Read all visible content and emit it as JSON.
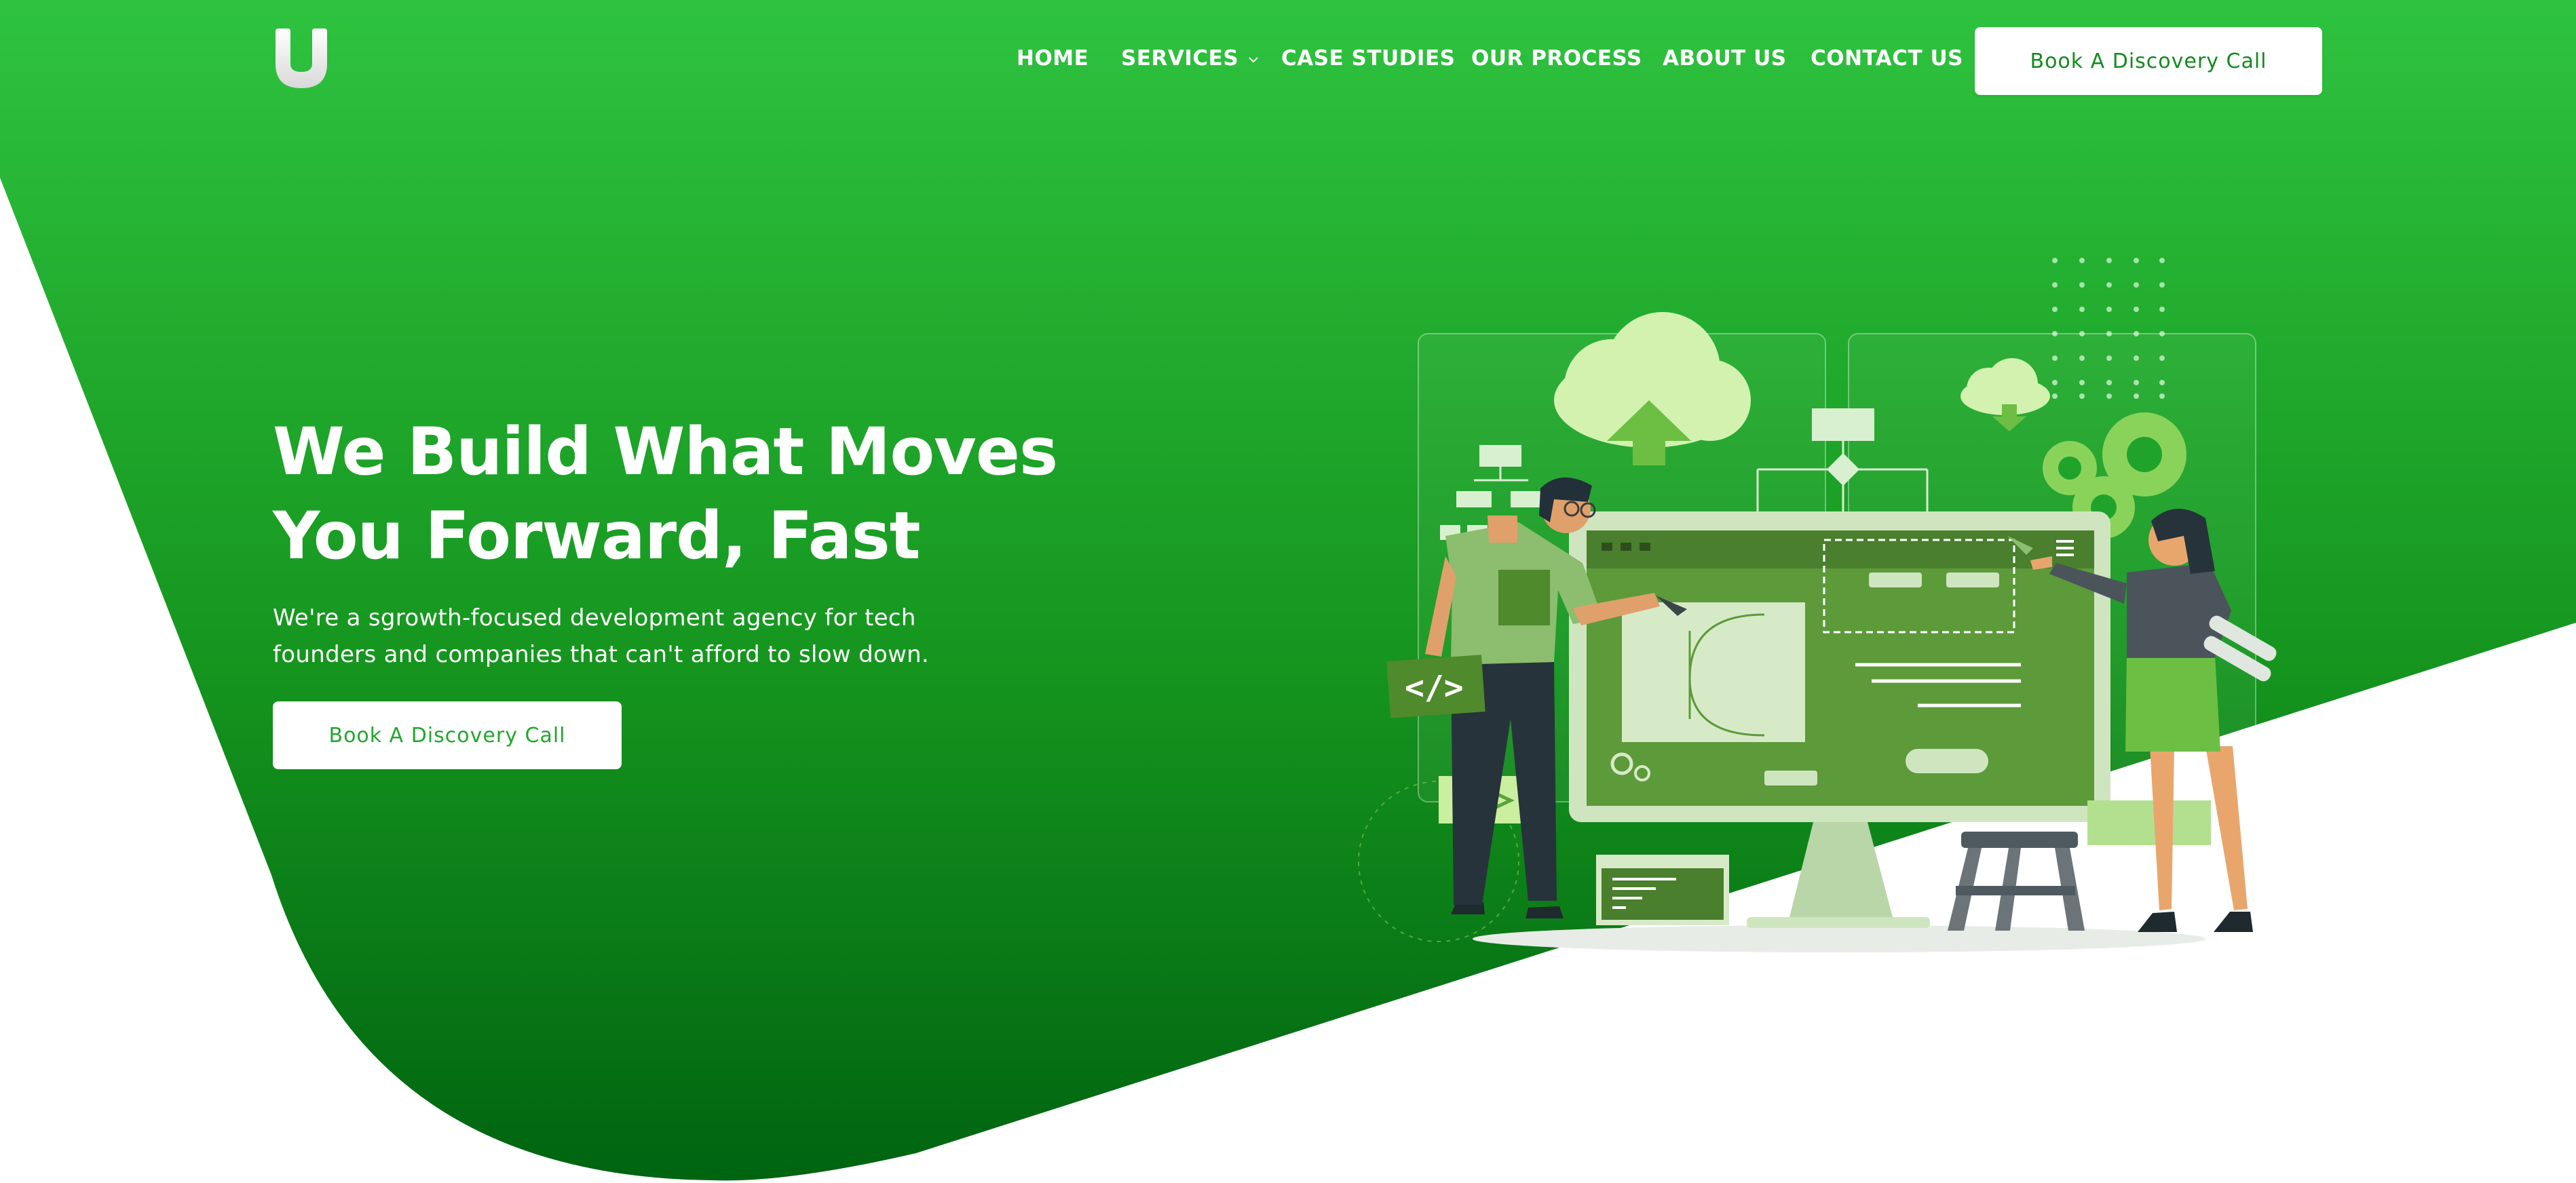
{
  "nav": {
    "items": [
      "HOME",
      "SERVICES",
      "CASE STUDIES",
      "OUR PROCESS",
      "ABOUT US",
      "CONTACT US"
    ],
    "cta_label": "Book A Discovery Call"
  },
  "hero": {
    "title_line1": "We Build What Moves",
    "title_line2": "You Forward, Fast",
    "subtitle_line1": "We're a sgrowth-focused development agency for tech",
    "subtitle_line2": "founders and companies that can't afford to slow down.",
    "cta_label": "Book A Discovery Call"
  },
  "icons": {
    "logo": "u-logo-icon",
    "services_dropdown": "chevron-down-icon",
    "code_tag": "code-tag-icon",
    "upload_cloud": "cloud-upload-icon",
    "download_cloud": "cloud-download-icon",
    "gears": "gears-icon"
  },
  "colors": {
    "green_top": "#2ec33f",
    "green_bottom": "#006a10",
    "white": "#ffffff",
    "button_text_nav": "#138a1e",
    "button_text_hero": "#22a62d"
  }
}
